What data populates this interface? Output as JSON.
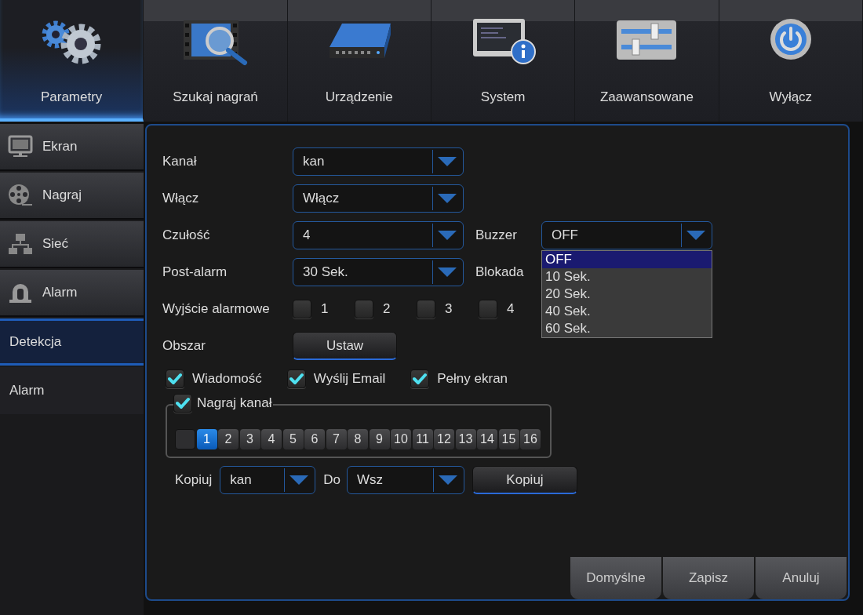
{
  "nav_tabs": [
    {
      "label": "Parametry",
      "selected": true
    },
    {
      "label": "Szukaj nagrań",
      "selected": false
    },
    {
      "label": "Urządzenie",
      "selected": false
    },
    {
      "label": "System",
      "selected": false
    },
    {
      "label": "Zaawansowane",
      "selected": false
    },
    {
      "label": "Wyłącz",
      "selected": false
    }
  ],
  "sidebar": {
    "items": [
      {
        "label": "Ekran",
        "kind": "section",
        "selected": false
      },
      {
        "label": "Nagraj",
        "kind": "section",
        "selected": false
      },
      {
        "label": "Sieć",
        "kind": "section",
        "selected": false
      },
      {
        "label": "Alarm",
        "kind": "section",
        "selected": false
      },
      {
        "label": "Detekcja",
        "kind": "sub",
        "selected": true
      },
      {
        "label": "Alarm",
        "kind": "sub",
        "selected": false
      }
    ]
  },
  "form": {
    "channel": {
      "label": "Kanał",
      "value": "kan"
    },
    "enable": {
      "label": "Włącz",
      "value": "Włącz"
    },
    "sensitivity": {
      "label": "Czułość",
      "value": "4"
    },
    "buzzer": {
      "label": "Buzzer",
      "value": "OFF",
      "expanded": true,
      "options": [
        {
          "label": "OFF",
          "selected": true
        },
        {
          "label": "10 Sek.",
          "selected": false
        },
        {
          "label": "20 Sek.",
          "selected": false
        },
        {
          "label": "40 Sek.",
          "selected": false
        },
        {
          "label": "60 Sek.",
          "selected": false
        }
      ]
    },
    "post_alarm": {
      "label": "Post-alarm",
      "value": "30 Sek."
    },
    "lockout": {
      "label": "Blokada"
    },
    "alarm_output": {
      "label": "Wyjście alarmowe",
      "outputs": [
        {
          "label": "1",
          "checked": false
        },
        {
          "label": "2",
          "checked": false
        },
        {
          "label": "3",
          "checked": false
        },
        {
          "label": "4",
          "checked": false
        }
      ]
    },
    "area": {
      "label": "Obszar",
      "button": "Ustaw"
    },
    "actions": [
      {
        "label": "Wiadomość",
        "checked": true
      },
      {
        "label": "Wyślij Email",
        "checked": true
      },
      {
        "label": "Pełny ekran",
        "checked": true
      }
    ],
    "record_channel": {
      "label": "Nagraj kanał",
      "checked": true,
      "all_checked": false,
      "channels": [
        {
          "label": "1",
          "selected": true
        },
        {
          "label": "2",
          "selected": false
        },
        {
          "label": "3",
          "selected": false
        },
        {
          "label": "4",
          "selected": false
        },
        {
          "label": "5",
          "selected": false
        },
        {
          "label": "6",
          "selected": false
        },
        {
          "label": "7",
          "selected": false
        },
        {
          "label": "8",
          "selected": false
        },
        {
          "label": "9",
          "selected": false
        },
        {
          "label": "10",
          "selected": false
        },
        {
          "label": "11",
          "selected": false
        },
        {
          "label": "12",
          "selected": false
        },
        {
          "label": "13",
          "selected": false
        },
        {
          "label": "14",
          "selected": false
        },
        {
          "label": "15",
          "selected": false
        },
        {
          "label": "16",
          "selected": false
        }
      ]
    },
    "copy": {
      "label": "Kopiuj",
      "from": "kan",
      "to_label": "Do",
      "to": "Wsz",
      "button": "Kopiuj"
    }
  },
  "buttons": [
    "Domyślne",
    "Zapisz",
    "Anuluj"
  ]
}
